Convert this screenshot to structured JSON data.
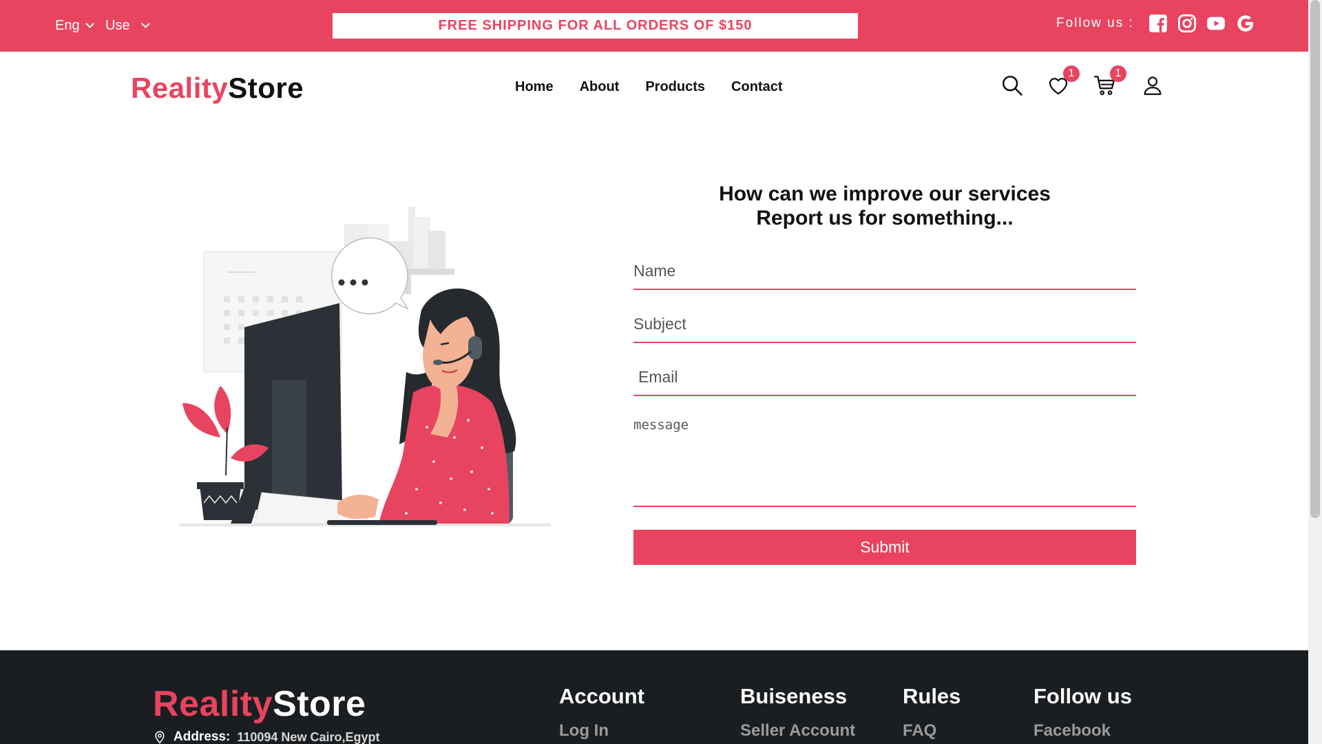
{
  "topbar": {
    "language": "Eng",
    "currency": "Use",
    "promo": "FREE SHIPPING FOR ALL ORDERS OF $150",
    "follow_label": "Follow us :",
    "social_icons": [
      "facebook-icon",
      "instagram-icon",
      "youtube-icon",
      "google-icon"
    ]
  },
  "header": {
    "logo_part1": "Reality",
    "logo_part2": "Store",
    "nav": [
      "Home",
      "About",
      "Products",
      "Contact"
    ],
    "wishlist_count": "1",
    "cart_count": "1"
  },
  "form": {
    "title_line1": "How can we improve our services",
    "title_line2": "Report us for something...",
    "name_placeholder": "Name",
    "subject_placeholder": "Subject",
    "email_placeholder": "Email",
    "message_placeholder": "message",
    "submit_label": "Submit"
  },
  "footer": {
    "logo_part1": "Reality",
    "logo_part2": "Store",
    "address_label": "Address:",
    "address_value": "110094 New Cairo,Egypt",
    "columns": [
      {
        "heading": "Account",
        "link": "Log In"
      },
      {
        "heading": "Buiseness",
        "link": "Seller Account"
      },
      {
        "heading": "Rules",
        "link": "FAQ"
      },
      {
        "heading": "Follow us",
        "link": "Facebook"
      }
    ]
  },
  "colors": {
    "brand": "#e8445f",
    "footer_bg": "#1b1e21"
  }
}
